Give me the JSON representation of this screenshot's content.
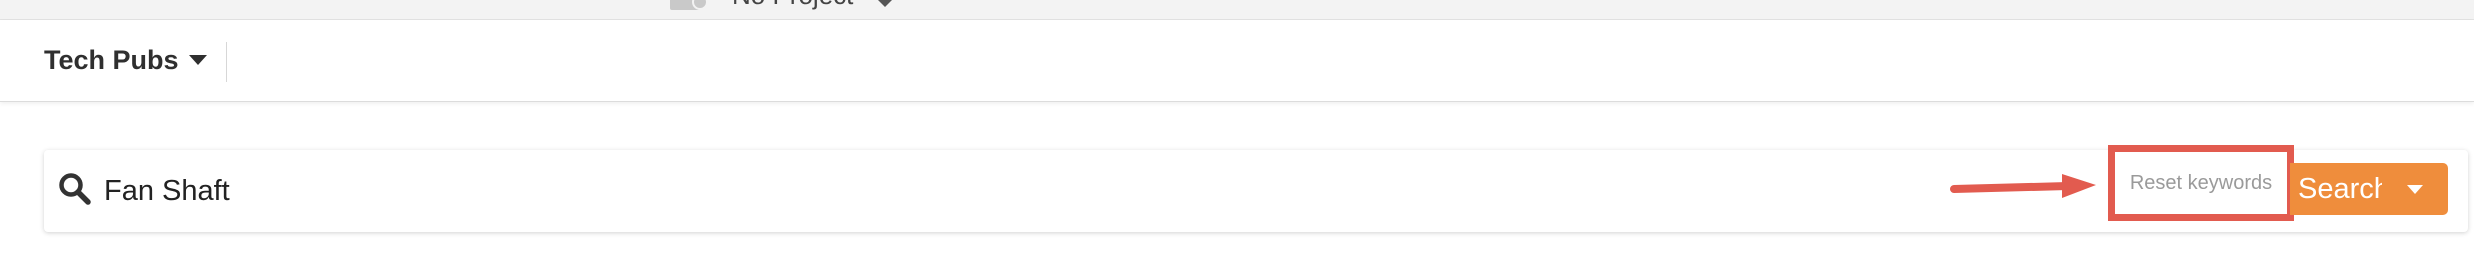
{
  "project_selector": {
    "label": "No Project",
    "icon": "folder-icon"
  },
  "header": {
    "brand_label": "Tech Pubs",
    "brand_caret_icon": "caret-down-icon"
  },
  "search": {
    "icon": "search-icon",
    "value": "Fan Shaft",
    "reset_label": "Reset keywords",
    "button_label": "Search",
    "dropdown_icon": "caret-down-icon"
  },
  "colors": {
    "accent": "#ef8d3c",
    "annotation": "#e25b4f",
    "text_dark": "#2f2f2f"
  }
}
